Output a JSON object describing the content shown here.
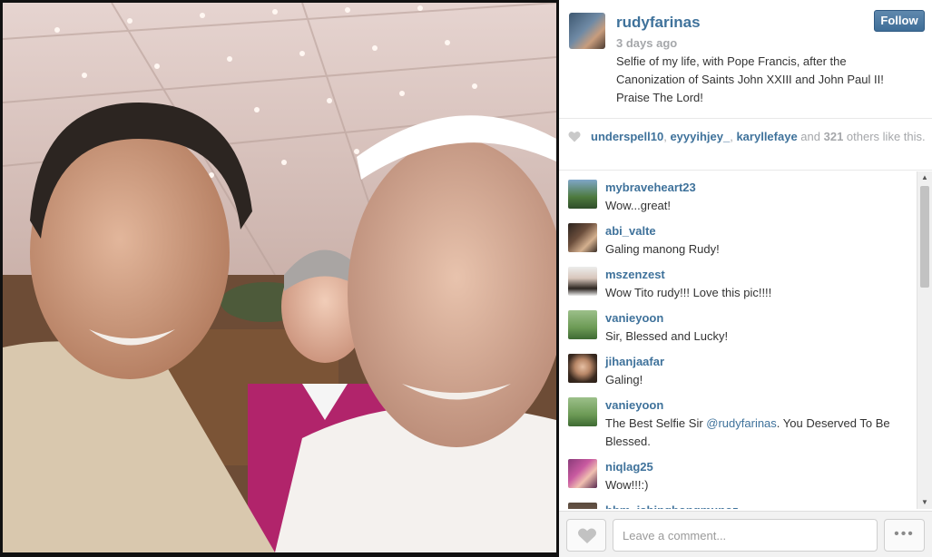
{
  "post": {
    "owner": "rudyfarinas",
    "time": "3 days ago",
    "caption": "Selfie of my life, with Pope Francis, after the Canonization of Saints John XXIII and John Paul II! Praise The Lord!",
    "follow_label": "Follow"
  },
  "likes": {
    "user1": "underspell10",
    "sep1": ", ",
    "user2": "eyyyihjey_",
    "sep2": ", ",
    "user3": "karyllefaye",
    "and_text": " and ",
    "count": "321",
    "suffix": " others like this."
  },
  "comments": [
    {
      "user": "mybraveheart23",
      "text": "Wow...great!"
    },
    {
      "user": "abi_valte",
      "text": "Galing manong Rudy!"
    },
    {
      "user": "mszenzest",
      "text": "Wow Tito rudy!!! Love this pic!!!!"
    },
    {
      "user": "vanieyoon",
      "text": "Sir, Blessed and Lucky!"
    },
    {
      "user": "jihanjaafar",
      "text": "Galing!"
    },
    {
      "user": "vanieyoon",
      "text_before": "The Best Selfie Sir ",
      "mention": "@rudyfarinas",
      "text_after": ". You Deserved To Be Blessed."
    },
    {
      "user": "niqlag25",
      "text": "Wow!!!:)"
    },
    {
      "user": "bbm_ishingbongmunoz",
      "text": ""
    }
  ],
  "composer": {
    "placeholder": "Leave a comment...",
    "more_label": "•••"
  },
  "colors": {
    "link": "#3f729b",
    "follow_button": "#4a78a2",
    "muted": "#a5a7aa"
  },
  "icons": {
    "likes_heart": "heart-icon",
    "like_button": "heart-icon",
    "more": "ellipsis-icon"
  }
}
